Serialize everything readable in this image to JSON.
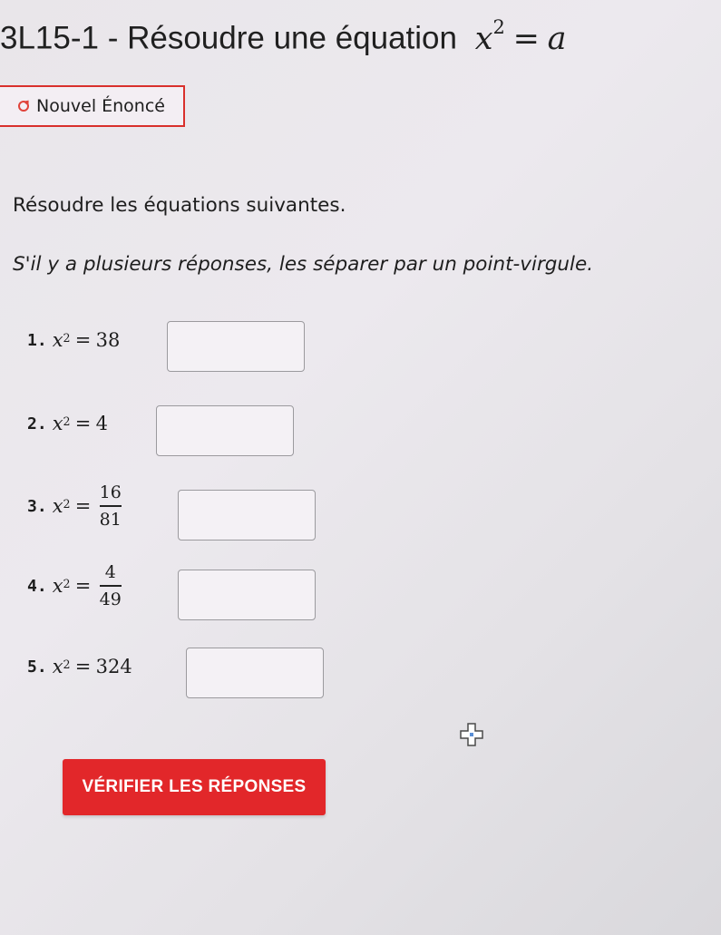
{
  "header": {
    "title_text": "3L15-1 - Résoudre une équation",
    "title_math": {
      "var": "x",
      "exp": "2",
      "eq": "=",
      "rhs": "a"
    }
  },
  "new_statement_button": {
    "label": "Nouvel Énoncé",
    "icon": "refresh-icon"
  },
  "instructions": {
    "line1": "Résoudre les équations suivantes.",
    "line2": "S'il y a plusieurs réponses, les séparer par un point-virgule."
  },
  "questions": [
    {
      "number": "1.",
      "var": "x",
      "exp": "2",
      "eq": "=",
      "rhs": "38",
      "answer": ""
    },
    {
      "number": "2.",
      "var": "x",
      "exp": "2",
      "eq": "=",
      "rhs": "4",
      "answer": ""
    },
    {
      "number": "3.",
      "var": "x",
      "exp": "2",
      "eq": "=",
      "numerator": "16",
      "denominator": "81",
      "answer": ""
    },
    {
      "number": "4.",
      "var": "x",
      "exp": "2",
      "eq": "=",
      "numerator": "4",
      "denominator": "49",
      "answer": ""
    },
    {
      "number": "5.",
      "var": "x",
      "exp": "2",
      "eq": "=",
      "rhs": "324",
      "answer": ""
    }
  ],
  "cursor_icon": "crosshair-cursor-icon",
  "verify_button": {
    "label": "VÉRIFIER LES RÉPONSES"
  },
  "colors": {
    "accent_red": "#e2272a",
    "border_red": "#d9302c",
    "input_border": "#9b9a9e"
  }
}
